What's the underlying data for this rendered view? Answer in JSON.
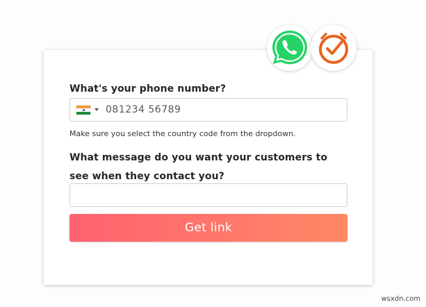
{
  "form": {
    "phone_label": "What's your phone number?",
    "phone_value": "081234 56789",
    "hint": "Make sure you select the country code from the dropdown.",
    "message_label": "What message do you want your customers to see when they contact you?",
    "message_value": "",
    "submit_label": "Get link"
  },
  "country": {
    "selected": "India",
    "icon": "india-flag-icon"
  },
  "logos": [
    "whatsapp-logo",
    "clock-logo"
  ],
  "colors": {
    "button_start": "#ff6270",
    "button_end": "#ff8866",
    "whatsapp_green": "#25d366",
    "clock_orange": "#e8631c"
  },
  "watermark": "wsxdn.com"
}
